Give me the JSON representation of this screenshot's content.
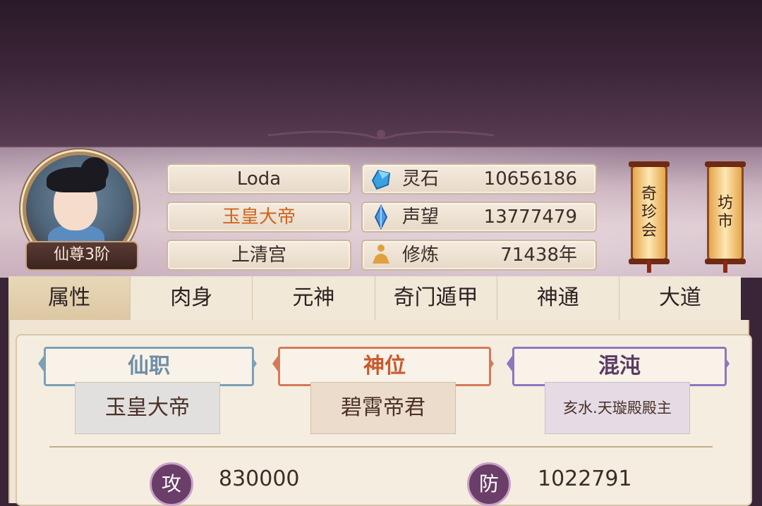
{
  "player": {
    "name": "Loda",
    "title": "玉皇大帝",
    "sect": "上清宫",
    "rank": "仙尊3阶"
  },
  "stats": [
    {
      "icon": "spirit-stone-icon",
      "label": "灵石",
      "value": "10656186"
    },
    {
      "icon": "prestige-crystal-icon",
      "label": "声望",
      "value": "13777479"
    },
    {
      "icon": "meditation-icon",
      "label": "修炼",
      "value": "71438年"
    }
  ],
  "side_buttons": [
    {
      "label": "奇珍会"
    },
    {
      "label": "坊市"
    }
  ],
  "tabs": [
    "属性",
    "肉身",
    "元神",
    "奇门遁甲",
    "神通",
    "大道"
  ],
  "active_tab": "属性",
  "ranks": [
    {
      "header": "仙职",
      "value": "玉皇大帝",
      "color": "#6e8ea8"
    },
    {
      "header": "神位",
      "value": "碧霄帝君",
      "color": "#c85a2e"
    },
    {
      "header": "混沌",
      "value": "亥水.天璇殿殿主",
      "color": "#5a3a62"
    }
  ],
  "attributes": [
    {
      "icon_text": "攻",
      "value": "830000"
    },
    {
      "icon_text": "防",
      "value": "1022791"
    }
  ]
}
